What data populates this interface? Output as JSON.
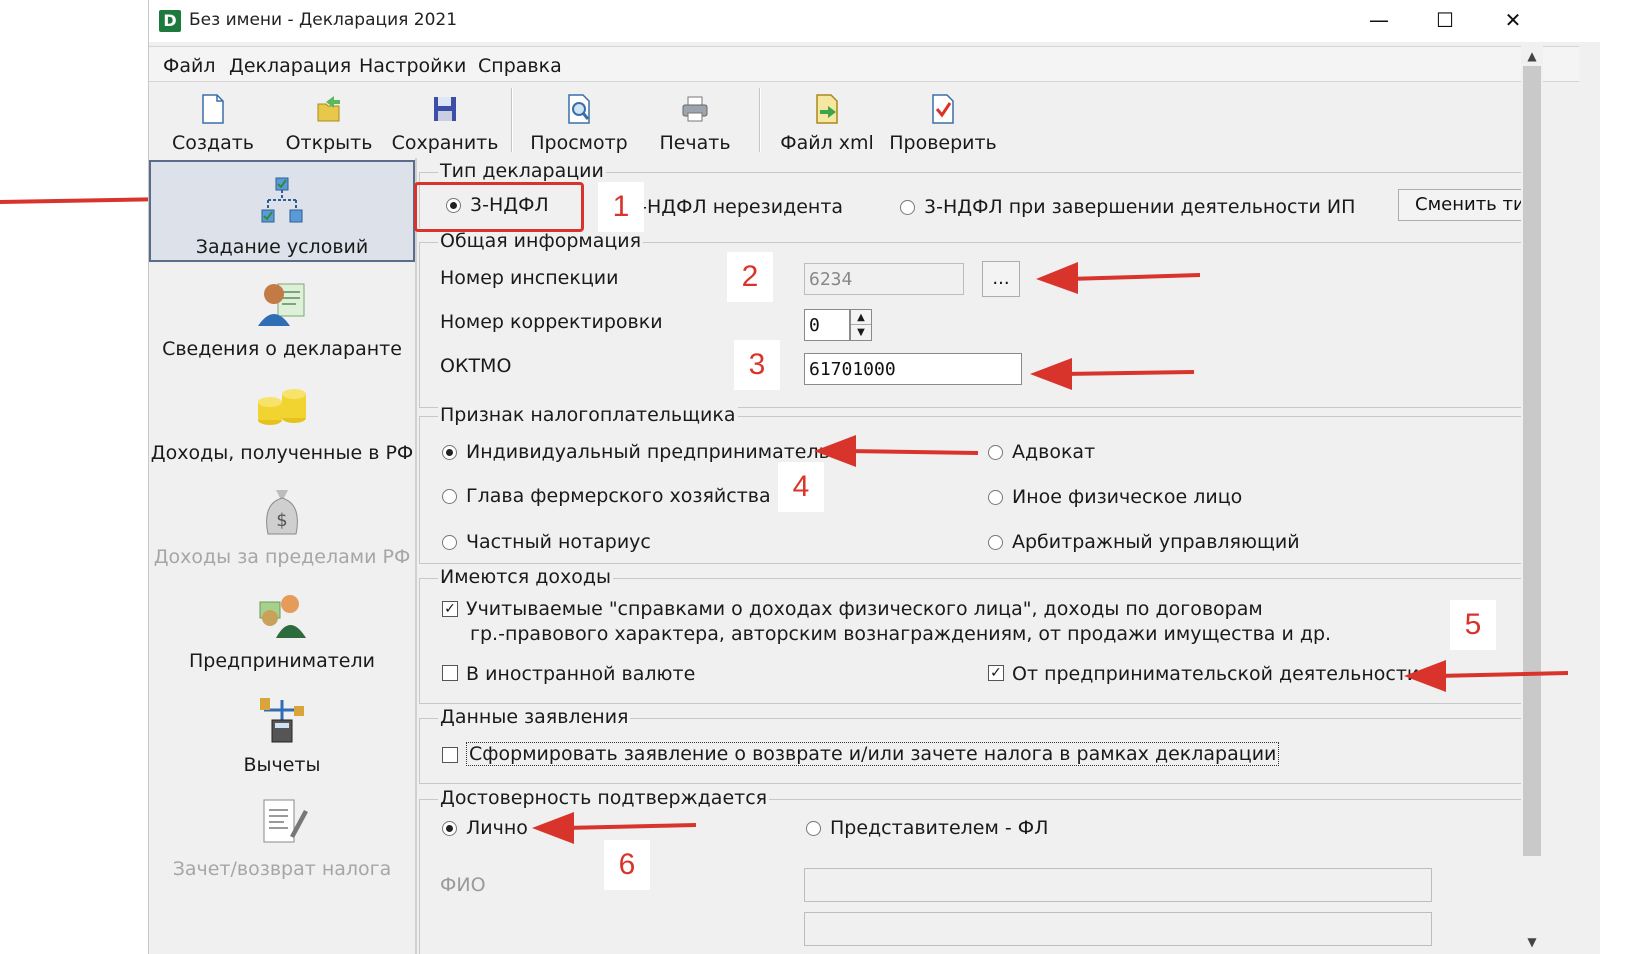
{
  "window": {
    "title": "Без имени - Декларация 2021",
    "app_icon": "D",
    "minimize": "—",
    "maximize": "☐",
    "close": "✕"
  },
  "menu": [
    "Файл",
    "Декларация",
    "Настройки",
    "Справка"
  ],
  "toolbar": [
    "Создать",
    "Открыть",
    "Сохранить",
    "Просмотр",
    "Печать",
    "Файл xml",
    "Проверить"
  ],
  "nav": [
    {
      "label": "Задание условий",
      "icon": "conditions-tree-icon",
      "active": true
    },
    {
      "label": "Сведения о декларанте",
      "icon": "person-card-icon"
    },
    {
      "label": "Доходы, полученные в РФ",
      "icon": "coins-stack-icon"
    },
    {
      "label": "Доходы за пределами РФ",
      "icon": "money-bag-icon",
      "disabled": true
    },
    {
      "label": "Предприниматели",
      "icon": "entrepreneur-icon"
    },
    {
      "label": "Вычеты",
      "icon": "scales-calculator-icon"
    },
    {
      "label": "Зачет/возврат налога",
      "icon": "document-pen-icon",
      "disabled": true
    }
  ],
  "decl_type": {
    "title": "Тип декларации",
    "opt1": "3-НДФЛ",
    "opt2": "3-НДФЛ нерезидента",
    "opt3": "3-НДФЛ при завершении деятельности ИП",
    "change_btn": "Сменить ти"
  },
  "general": {
    "title": "Общая информация",
    "inspection_label": "Номер инспекции",
    "inspection_value": "6234",
    "browse_btn": "...",
    "correction_label": "Номер корректировки",
    "correction_value": "0",
    "oktmo_label": "ОКТМО",
    "oktmo_value": "61701000"
  },
  "taxpayer": {
    "title": "Признак налогоплательщика",
    "ip": "Индивидуальный предприниматель",
    "lawyer": "Адвокат",
    "farmer": "Глава фермерского хозяйства",
    "other": "Иное физическое лицо",
    "notary": "Частный нотариус",
    "arbitration": "Арбитражный управляющий"
  },
  "income": {
    "title": "Имеются доходы",
    "cb1_line1": "Учитываемые \"справками о доходах физического лица\", доходы по договорам",
    "cb1_line2": "гр.-правового характера, авторским вознаграждениям, от продажи имущества и др.",
    "foreign": "В иностранной валюте",
    "business": "От предпринимательской деятельности"
  },
  "statement": {
    "title": "Данные заявления",
    "cb": "Сформировать заявление о  возврате и/или зачете налога в рамках декларации"
  },
  "confirm": {
    "title": "Достоверность подтверждается",
    "personal": "Лично",
    "representative": "Представителем - ФЛ",
    "fio_label": "ФИО"
  },
  "annotations": [
    "1",
    "2",
    "3",
    "4",
    "5",
    "6"
  ],
  "colors": {
    "annotation_red": "#d9342b",
    "active_nav_border": "#5a6b8c",
    "window_bg": "#f0f0f0"
  }
}
